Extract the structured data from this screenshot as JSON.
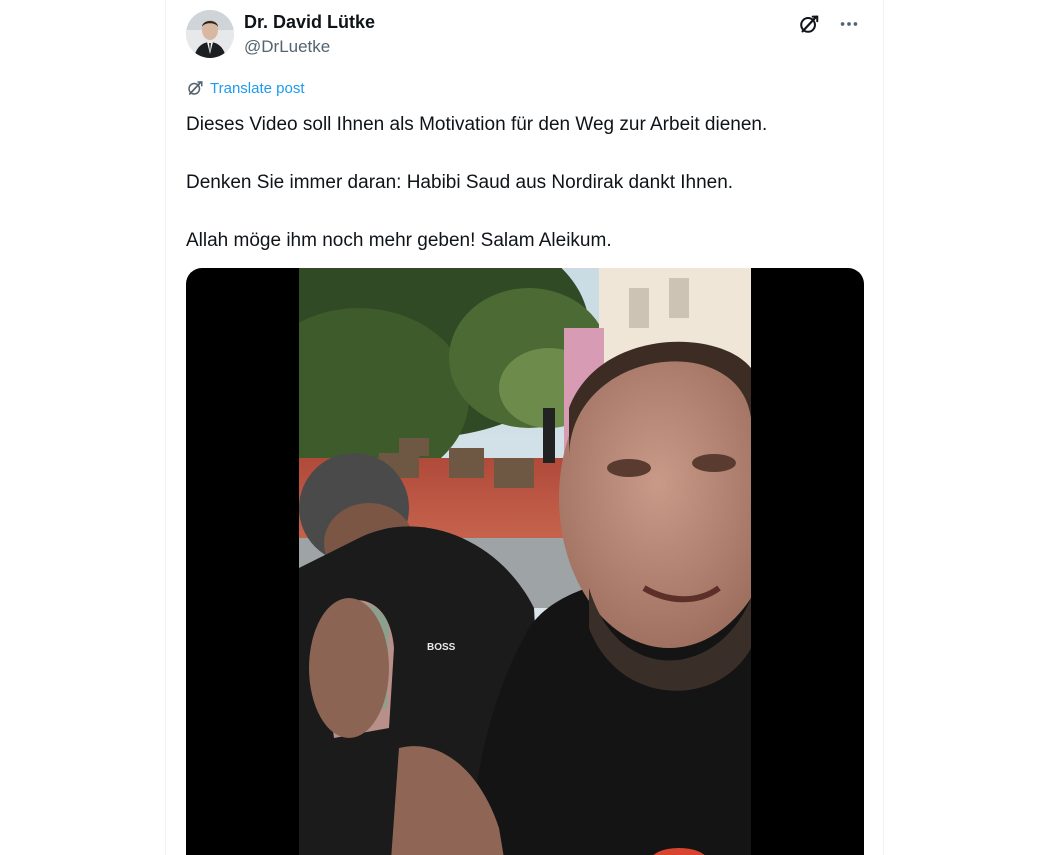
{
  "post": {
    "author_name": "Dr. David Lütke",
    "author_handle": "@DrLuetke",
    "translate_label": "Translate post",
    "paragraphs": [
      "Dieses Video soll Ihnen als Motivation für den Weg zur Arbeit dienen.",
      "Denken Sie immer daran: Habibi Saud aus Nordirak dankt Ihnen.",
      "Allah möge ihm noch mehr geben! Salam Aleikum."
    ]
  },
  "icons": {
    "grok": "grok-icon",
    "more": "more-horizontal-icon",
    "translate": "translate-icon"
  },
  "media": {
    "shirt_text": "BOSS"
  },
  "colors": {
    "link": "#1d9bf0",
    "text": "#0f1419",
    "muted": "#536471"
  }
}
